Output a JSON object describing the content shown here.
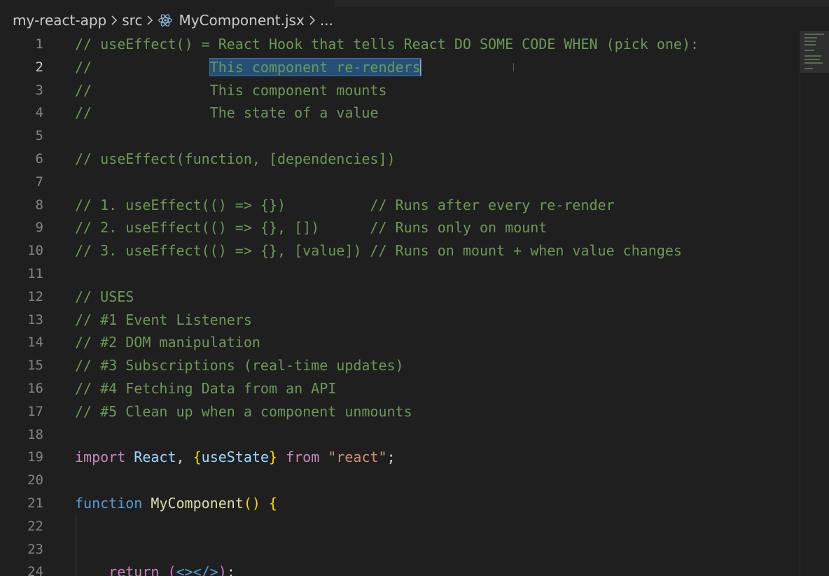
{
  "breadcrumb": {
    "project": "my-react-app",
    "folder": "src",
    "file": "MyComponent.jsx",
    "more": "...",
    "separator_icon": "chevron-right-icon",
    "file_icon": "react-icon"
  },
  "editor": {
    "current_line": 2,
    "selected_text": "This component re-renders",
    "colors": {
      "background": "#1f1f1f",
      "comment": "#6a9955",
      "keyword": "#569cd6",
      "variable": "#9cdcfe",
      "function": "#dcdcaa",
      "string": "#ce9178",
      "selection": "#264f78"
    },
    "lines": [
      {
        "n": "1",
        "tokens": [
          {
            "t": "// useEffect() = React Hook that tells React DO SOME CODE WHEN (pick one):",
            "c": "comment"
          }
        ]
      },
      {
        "n": "2",
        "tokens": [
          {
            "t": "//              ",
            "c": "comment"
          },
          {
            "t": "This component re-renders",
            "c": "comment",
            "sel": true
          }
        ]
      },
      {
        "n": "3",
        "tokens": [
          {
            "t": "//              This component mounts",
            "c": "comment"
          }
        ]
      },
      {
        "n": "4",
        "tokens": [
          {
            "t": "//              The state of a value",
            "c": "comment"
          }
        ]
      },
      {
        "n": "5",
        "tokens": []
      },
      {
        "n": "6",
        "tokens": [
          {
            "t": "// useEffect(function, [dependencies])",
            "c": "comment"
          }
        ]
      },
      {
        "n": "7",
        "tokens": []
      },
      {
        "n": "8",
        "tokens": [
          {
            "t": "// 1. useEffect(() => {})          // Runs after every re-render",
            "c": "comment"
          }
        ]
      },
      {
        "n": "9",
        "tokens": [
          {
            "t": "// 2. useEffect(() => {}, [])      // Runs only on mount",
            "c": "comment"
          }
        ]
      },
      {
        "n": "10",
        "tokens": [
          {
            "t": "// 3. useEffect(() => {}, [value]) // Runs on mount + when value changes",
            "c": "comment"
          }
        ]
      },
      {
        "n": "11",
        "tokens": []
      },
      {
        "n": "12",
        "tokens": [
          {
            "t": "// USES",
            "c": "comment"
          }
        ]
      },
      {
        "n": "13",
        "tokens": [
          {
            "t": "// #1 Event Listeners",
            "c": "comment"
          }
        ]
      },
      {
        "n": "14",
        "tokens": [
          {
            "t": "// #2 DOM manipulation",
            "c": "comment"
          }
        ]
      },
      {
        "n": "15",
        "tokens": [
          {
            "t": "// #3 Subscriptions (real-time updates)",
            "c": "comment"
          }
        ]
      },
      {
        "n": "16",
        "tokens": [
          {
            "t": "// #4 Fetching Data from an API",
            "c": "comment"
          }
        ]
      },
      {
        "n": "17",
        "tokens": [
          {
            "t": "// #5 Clean up when a component unmounts",
            "c": "comment"
          }
        ]
      },
      {
        "n": "18",
        "tokens": []
      },
      {
        "n": "19",
        "tokens": [
          {
            "t": "import",
            "c": "kw2"
          },
          {
            "t": " ",
            "c": "plain"
          },
          {
            "t": "React",
            "c": "var"
          },
          {
            "t": ", ",
            "c": "plain"
          },
          {
            "t": "{",
            "c": "br"
          },
          {
            "t": "useState",
            "c": "var"
          },
          {
            "t": "}",
            "c": "br"
          },
          {
            "t": " ",
            "c": "plain"
          },
          {
            "t": "from",
            "c": "kw2"
          },
          {
            "t": " ",
            "c": "plain"
          },
          {
            "t": "\"react\"",
            "c": "str"
          },
          {
            "t": ";",
            "c": "plain"
          }
        ]
      },
      {
        "n": "20",
        "tokens": []
      },
      {
        "n": "21",
        "tokens": [
          {
            "t": "function",
            "c": "kw"
          },
          {
            "t": " ",
            "c": "plain"
          },
          {
            "t": "MyComponent",
            "c": "fn"
          },
          {
            "t": "()",
            "c": "br"
          },
          {
            "t": " ",
            "c": "plain"
          },
          {
            "t": "{",
            "c": "br"
          }
        ]
      },
      {
        "n": "22",
        "tokens": []
      },
      {
        "n": "23",
        "tokens": []
      },
      {
        "n": "24",
        "tokens": [
          {
            "t": "    ",
            "c": "plain"
          },
          {
            "t": "return",
            "c": "kw2"
          },
          {
            "t": " ",
            "c": "plain"
          },
          {
            "t": "(",
            "c": "br2"
          },
          {
            "t": "<></>",
            "c": "kw"
          },
          {
            "t": ")",
            "c": "br2"
          },
          {
            "t": ";",
            "c": "plain"
          }
        ]
      }
    ]
  }
}
